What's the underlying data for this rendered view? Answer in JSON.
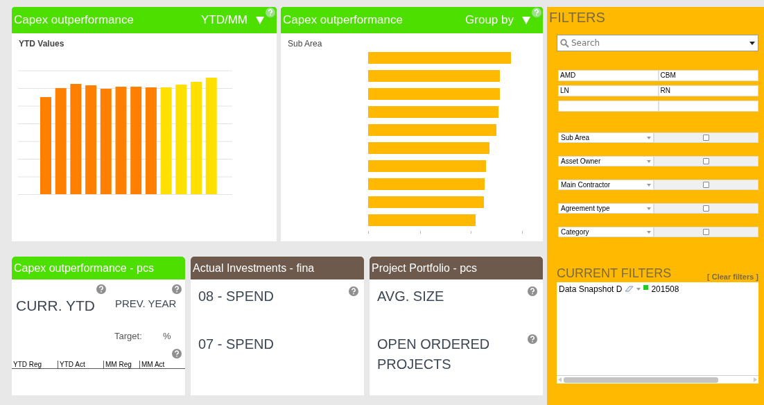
{
  "panels": [
    {
      "title": "Capex outperformance",
      "control": "YTD/MM",
      "subtitle": "YTD Values",
      "kind": "columns"
    },
    {
      "title": "Capex outperformance",
      "control": "Group by",
      "subtitle": "Sub Area",
      "kind": "hbars"
    }
  ],
  "cards": [
    {
      "kind": "kpi",
      "title": "Capex outperformance  -  pcs",
      "color": "#4cdf00",
      "main": "CURR. YTD",
      "secondary": "PREV. YEAR",
      "target_label": "Target:",
      "target_unit": "%",
      "columns": [
        "YTD Reg",
        "YTD Act",
        "MM Reg",
        "MM Act"
      ]
    },
    {
      "kind": "metrics",
      "title": "Actual Investments  -  fina",
      "color": "#6e5a4c",
      "metrics": [
        {
          "label": "08 - SPEND",
          "help": true
        },
        {
          "label": "07 - SPEND",
          "help": false
        }
      ]
    },
    {
      "kind": "metrics",
      "title": "Project Portfolio  -  pcs",
      "color": "#6e5a4c",
      "metrics": [
        {
          "label": "AVG. SIZE",
          "help": true
        },
        {
          "label": "OPEN ORDERED PROJECTS",
          "help": true
        }
      ]
    }
  ],
  "filters": {
    "title": "FILTERS",
    "search": {
      "placeholder": "Search"
    },
    "grid": [
      [
        "AMD",
        "CBM"
      ],
      [
        "LN",
        "RN"
      ]
    ],
    "dropdowns": [
      {
        "label": "Sub Area",
        "checked": false
      },
      {
        "label": "Asset Owner",
        "checked": false
      },
      {
        "label": "Main Contractor",
        "checked": false
      },
      {
        "label": "Agreement type",
        "checked": false
      },
      {
        "label": "Category",
        "checked": false
      }
    ],
    "current_title": "CURRENT FILTERS",
    "clear": "[ Clear filters ]",
    "current": [
      {
        "field": "Data Snapshot D",
        "value": "201508",
        "color": "#22cc22"
      }
    ]
  }
}
